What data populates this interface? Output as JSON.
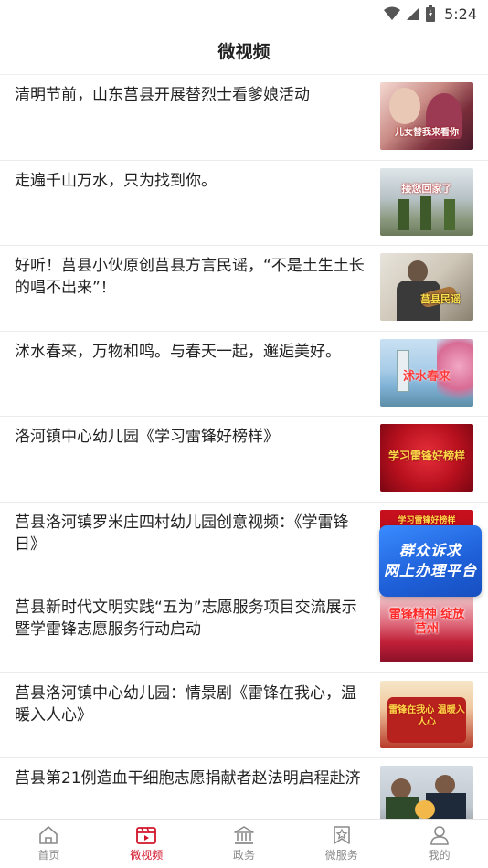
{
  "status_bar": {
    "time": "5:24"
  },
  "header": {
    "title": "微视频"
  },
  "items": [
    {
      "title": "清明节前，山东莒县开展替烈士看爹娘活动",
      "thumb_text": "儿女替我来看你"
    },
    {
      "title": "走遍千山万水，只为找到你。",
      "thumb_text": "接您回家了"
    },
    {
      "title": "好听！莒县小伙原创莒县方言民谣，“不是土生土长的唱不出来”！",
      "thumb_text": "莒县民谣"
    },
    {
      "title": "沭水春来，万物和鸣。与春天一起，邂逅美好。",
      "thumb_text": "沭水春来"
    },
    {
      "title": "洛河镇中心幼儿园《学习雷锋好榜样》",
      "thumb_text": "学习雷锋好榜样"
    },
    {
      "title": "莒县洛河镇罗米庄四村幼儿园创意视频：《学雷锋日》",
      "thumb_text": "学习雷锋好榜样"
    },
    {
      "title": "莒县新时代文明实践“五为”志愿服务项目交流展示暨学雷锋志愿服务行动启动",
      "thumb_text": "雷锋精神 绽放莒州"
    },
    {
      "title": "莒县洛河镇中心幼儿园：情景剧《雷锋在我心，温暖入人心》",
      "thumb_text": "雷锋在我心 温暖入人心"
    },
    {
      "title": "莒县第21例造血干细胞志愿捐献者赵法明启程赴济",
      "thumb_text": ""
    }
  ],
  "float_banner": {
    "line1": "群众诉求",
    "line2": "网上办理平台"
  },
  "tabs": [
    {
      "label": "首页",
      "icon": "home-icon",
      "active": false
    },
    {
      "label": "微视频",
      "icon": "video-icon",
      "active": true
    },
    {
      "label": "政务",
      "icon": "government-icon",
      "active": false
    },
    {
      "label": "微服务",
      "icon": "service-icon",
      "active": false
    },
    {
      "label": "我的",
      "icon": "profile-icon",
      "active": false
    }
  ],
  "colors": {
    "accent": "#d2142a",
    "inactive": "#8a8a8a",
    "banner": "#1e5fd8"
  }
}
